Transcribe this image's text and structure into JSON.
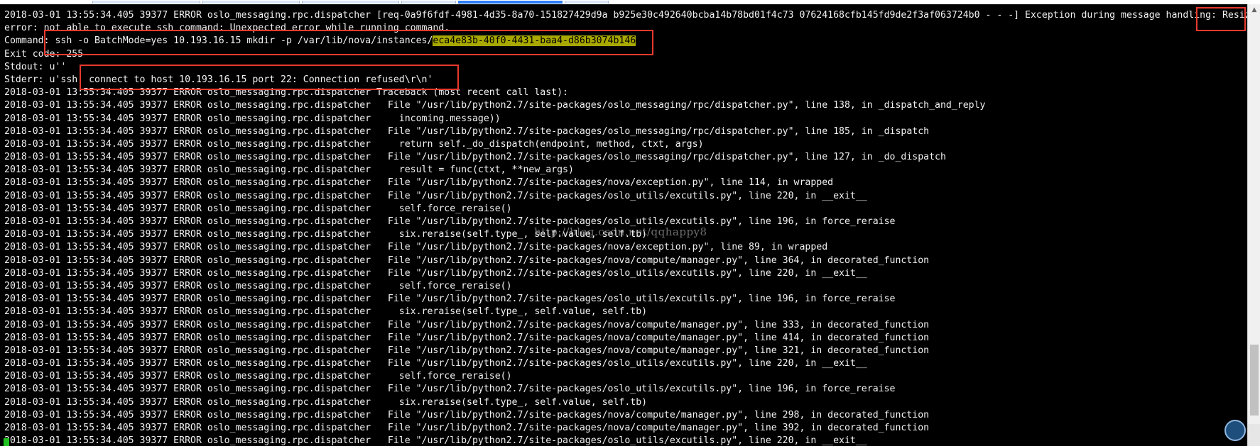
{
  "terminal": {
    "lines": [
      {
        "text": "2018-03-01 13:55:34.405 39377 ERROR oslo_messaging.rpc.dispatcher [req-0a9f6fdf-4981-4d35-8a70-151827429d9a b925e30c492640bcba14b78bd01f4c73 07624168cfb145fd9de2f3af063724b0 - - -] Exception during message handling: Resize"
      },
      {
        "text": "error: not able to execute ssh command: Unexpected error while running command."
      },
      {
        "text": "Command: ssh -o BatchMode=yes 10.193.16.15 mkdir -p /var/lib/nova/instances/",
        "highlight": "eca4e83b-40f0-4431-baa4-d86b3074b146"
      },
      {
        "text": "Exit code: 255"
      },
      {
        "text": "Stdout: u''"
      },
      {
        "text": "Stderr: u'ssh: connect to host 10.193.16.15 port 22: Connection refused\\r\\n'"
      },
      {
        "text": "2018-03-01 13:55:34.405 39377 ERROR oslo_messaging.rpc.dispatcher Traceback (most recent call last):"
      },
      {
        "text": "2018-03-01 13:55:34.405 39377 ERROR oslo_messaging.rpc.dispatcher   File \"/usr/lib/python2.7/site-packages/oslo_messaging/rpc/dispatcher.py\", line 138, in _dispatch_and_reply"
      },
      {
        "text": "2018-03-01 13:55:34.405 39377 ERROR oslo_messaging.rpc.dispatcher     incoming.message))"
      },
      {
        "text": "2018-03-01 13:55:34.405 39377 ERROR oslo_messaging.rpc.dispatcher   File \"/usr/lib/python2.7/site-packages/oslo_messaging/rpc/dispatcher.py\", line 185, in _dispatch"
      },
      {
        "text": "2018-03-01 13:55:34.405 39377 ERROR oslo_messaging.rpc.dispatcher     return self._do_dispatch(endpoint, method, ctxt, args)"
      },
      {
        "text": "2018-03-01 13:55:34.405 39377 ERROR oslo_messaging.rpc.dispatcher   File \"/usr/lib/python2.7/site-packages/oslo_messaging/rpc/dispatcher.py\", line 127, in _do_dispatch"
      },
      {
        "text": "2018-03-01 13:55:34.405 39377 ERROR oslo_messaging.rpc.dispatcher     result = func(ctxt, **new_args)"
      },
      {
        "text": "2018-03-01 13:55:34.405 39377 ERROR oslo_messaging.rpc.dispatcher   File \"/usr/lib/python2.7/site-packages/nova/exception.py\", line 114, in wrapped"
      },
      {
        "text": "2018-03-01 13:55:34.405 39377 ERROR oslo_messaging.rpc.dispatcher   File \"/usr/lib/python2.7/site-packages/oslo_utils/excutils.py\", line 220, in __exit__"
      },
      {
        "text": "2018-03-01 13:55:34.405 39377 ERROR oslo_messaging.rpc.dispatcher     self.force_reraise()"
      },
      {
        "text": "2018-03-01 13:55:34.405 39377 ERROR oslo_messaging.rpc.dispatcher   File \"/usr/lib/python2.7/site-packages/oslo_utils/excutils.py\", line 196, in force_reraise"
      },
      {
        "text": "2018-03-01 13:55:34.405 39377 ERROR oslo_messaging.rpc.dispatcher     six.reraise(self.type_, self.value, self.tb)"
      },
      {
        "text": "2018-03-01 13:55:34.405 39377 ERROR oslo_messaging.rpc.dispatcher   File \"/usr/lib/python2.7/site-packages/nova/exception.py\", line 89, in wrapped"
      },
      {
        "text": "2018-03-01 13:55:34.405 39377 ERROR oslo_messaging.rpc.dispatcher   File \"/usr/lib/python2.7/site-packages/nova/compute/manager.py\", line 364, in decorated_function"
      },
      {
        "text": "2018-03-01 13:55:34.405 39377 ERROR oslo_messaging.rpc.dispatcher   File \"/usr/lib/python2.7/site-packages/oslo_utils/excutils.py\", line 220, in __exit__"
      },
      {
        "text": "2018-03-01 13:55:34.405 39377 ERROR oslo_messaging.rpc.dispatcher     self.force_reraise()"
      },
      {
        "text": "2018-03-01 13:55:34.405 39377 ERROR oslo_messaging.rpc.dispatcher   File \"/usr/lib/python2.7/site-packages/oslo_utils/excutils.py\", line 196, in force_reraise"
      },
      {
        "text": "2018-03-01 13:55:34.405 39377 ERROR oslo_messaging.rpc.dispatcher     six.reraise(self.type_, self.value, self.tb)"
      },
      {
        "text": "2018-03-01 13:55:34.405 39377 ERROR oslo_messaging.rpc.dispatcher   File \"/usr/lib/python2.7/site-packages/nova/compute/manager.py\", line 333, in decorated_function"
      },
      {
        "text": "2018-03-01 13:55:34.405 39377 ERROR oslo_messaging.rpc.dispatcher   File \"/usr/lib/python2.7/site-packages/nova/compute/manager.py\", line 414, in decorated_function"
      },
      {
        "text": "2018-03-01 13:55:34.405 39377 ERROR oslo_messaging.rpc.dispatcher   File \"/usr/lib/python2.7/site-packages/nova/compute/manager.py\", line 321, in decorated_function"
      },
      {
        "text": "2018-03-01 13:55:34.405 39377 ERROR oslo_messaging.rpc.dispatcher   File \"/usr/lib/python2.7/site-packages/oslo_utils/excutils.py\", line 220, in __exit__"
      },
      {
        "text": "2018-03-01 13:55:34.405 39377 ERROR oslo_messaging.rpc.dispatcher     self.force_reraise()"
      },
      {
        "text": "2018-03-01 13:55:34.405 39377 ERROR oslo_messaging.rpc.dispatcher   File \"/usr/lib/python2.7/site-packages/oslo_utils/excutils.py\", line 196, in force_reraise"
      },
      {
        "text": "2018-03-01 13:55:34.405 39377 ERROR oslo_messaging.rpc.dispatcher     six.reraise(self.type_, self.value, self.tb)"
      },
      {
        "text": "2018-03-01 13:55:34.405 39377 ERROR oslo_messaging.rpc.dispatcher   File \"/usr/lib/python2.7/site-packages/nova/compute/manager.py\", line 298, in decorated_function"
      },
      {
        "text": "2018-03-01 13:55:34.405 39377 ERROR oslo_messaging.rpc.dispatcher   File \"/usr/lib/python2.7/site-packages/nova/compute/manager.py\", line 392, in decorated_function"
      },
      {
        "text": "2018-03-01 13:55:34.405 39377 ERROR oslo_messaging.rpc.dispatcher   File \"/usr/lib/python2.7/site-packages/oslo_utils/excutils.py\", line 220, in __exit__"
      }
    ],
    "watermark": "http://blog.csdn.net/qqhappy8",
    "colors": {
      "background": "#000000",
      "text": "#f2f2f2",
      "highlight": "#a8a800",
      "annotation_box": "#e83a2e",
      "cursor": "#20c020"
    }
  },
  "scrollbar": {
    "up_arrow_icon": "triangle-up-icon"
  }
}
